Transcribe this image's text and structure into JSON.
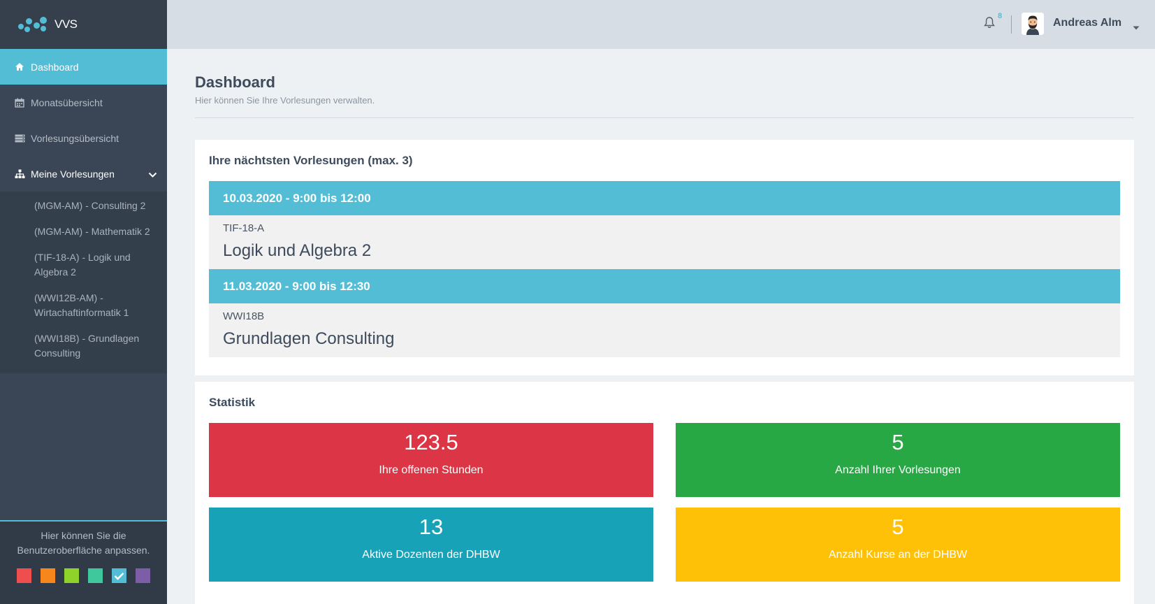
{
  "app": {
    "name": "VVS"
  },
  "sidebar": {
    "items": [
      {
        "label": "Dashboard",
        "icon": "home-icon",
        "active": true
      },
      {
        "label": "Monatsübersicht",
        "icon": "calendar-icon"
      },
      {
        "label": "Vorlesungsübersicht",
        "icon": "server-icon"
      },
      {
        "label": "Meine Vorlesungen",
        "icon": "sitemap-icon",
        "expanded": true
      }
    ],
    "sub_items": [
      {
        "label": "(MGM-AM) - Consulting 2"
      },
      {
        "label": "(MGM-AM) - Mathematik 2"
      },
      {
        "label": "(TIF-18-A) - Logik und Algebra 2"
      },
      {
        "label": "(WWI12B-AM) - Wirtachaftinformatik 1"
      },
      {
        "label": "(WWI18B) - Grundlagen Consulting"
      }
    ],
    "customize": {
      "text": "Hier können Sie die Benutzeroberfläche anpassen.",
      "swatches": [
        "#f04e4e",
        "#f7861c",
        "#8fd22a",
        "#3fc89c",
        "#53bdd6",
        "#7d5ca8"
      ],
      "selected": 4
    }
  },
  "topbar": {
    "notification_count": "8",
    "user_name": "Andreas Alm"
  },
  "page": {
    "title": "Dashboard",
    "subtitle": "Hier können Sie Ihre Vorlesungen verwalten."
  },
  "next_lectures": {
    "title": "Ihre nächtsten Vorlesungen (max. 3)",
    "items": [
      {
        "datetime": "10.03.2020 - 9:00 bis 12:00",
        "course": "TIF-18-A",
        "name": "Logik und Algebra 2"
      },
      {
        "datetime": "11.03.2020 - 9:00 bis 12:30",
        "course": "WWI18B",
        "name": "Grundlagen Consulting"
      }
    ]
  },
  "statistics": {
    "title": "Statistik",
    "tiles": [
      {
        "value": "123.5",
        "label": "Ihre offenen Stunden",
        "color": "#dc3545"
      },
      {
        "value": "5",
        "label": "Anzahl Ihrer Vorlesungen",
        "color": "#28a745"
      },
      {
        "value": "13",
        "label": "Aktive Dozenten der DHBW",
        "color": "#17a2b8"
      },
      {
        "value": "5",
        "label": "Anzahl Kurse an der DHBW",
        "color": "#ffc107"
      }
    ]
  },
  "colors": {
    "accent": "#53bdd6",
    "sidebar_bg": "#3a4655",
    "topbar_bg": "#d7dde4"
  }
}
